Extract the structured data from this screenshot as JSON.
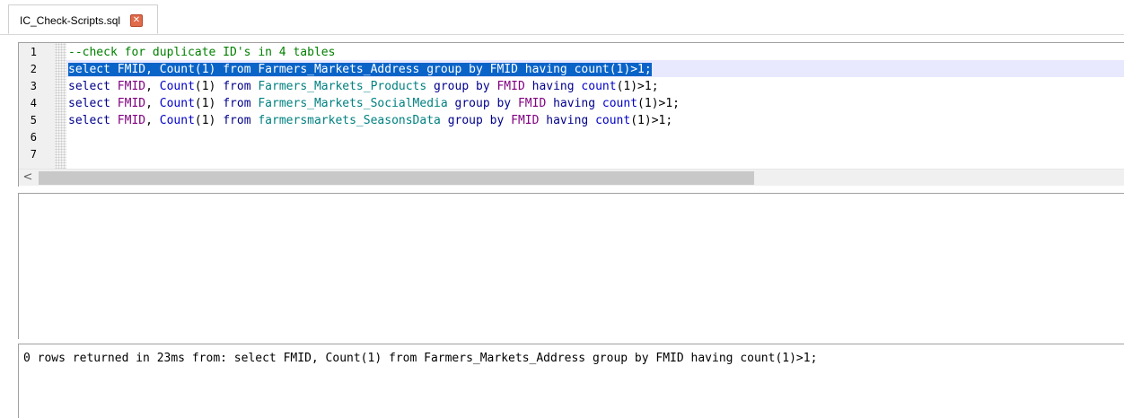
{
  "tabs": [
    {
      "label": "IC_Check-Scripts.sql",
      "close_icon": "close-icon",
      "close_glyph": "✕",
      "close_color": "#e06a4a"
    }
  ],
  "editor": {
    "line_numbers": [
      "1",
      "2",
      "3",
      "4",
      "5",
      "6",
      "7"
    ],
    "selected_line": "2",
    "lines": [
      {
        "tokens": [
          {
            "t": "--check for duplicate ID's in 4 tables",
            "k": "comment"
          }
        ]
      },
      {
        "tokens": [
          {
            "t": "select",
            "k": "kw"
          },
          {
            "t": " "
          },
          {
            "t": "FMID",
            "k": "ident"
          },
          {
            "t": ", "
          },
          {
            "t": "Count",
            "k": "func"
          },
          {
            "t": "(1) "
          },
          {
            "t": "from",
            "k": "kw"
          },
          {
            "t": " "
          },
          {
            "t": "Farmers_Markets_Address",
            "k": "table"
          },
          {
            "t": " "
          },
          {
            "t": "group by",
            "k": "kw"
          },
          {
            "t": " "
          },
          {
            "t": "FMID",
            "k": "ident"
          },
          {
            "t": " "
          },
          {
            "t": "having",
            "k": "kw"
          },
          {
            "t": " "
          },
          {
            "t": "count",
            "k": "func"
          },
          {
            "t": "(1)>1;"
          }
        ]
      },
      {
        "tokens": [
          {
            "t": "select",
            "k": "kw"
          },
          {
            "t": " "
          },
          {
            "t": "FMID",
            "k": "ident"
          },
          {
            "t": ", "
          },
          {
            "t": "Count",
            "k": "func"
          },
          {
            "t": "(1) "
          },
          {
            "t": "from",
            "k": "kw"
          },
          {
            "t": " "
          },
          {
            "t": "Farmers_Markets_Products",
            "k": "table"
          },
          {
            "t": " "
          },
          {
            "t": "group by",
            "k": "kw"
          },
          {
            "t": " "
          },
          {
            "t": "FMID",
            "k": "ident"
          },
          {
            "t": " "
          },
          {
            "t": "having",
            "k": "kw"
          },
          {
            "t": " "
          },
          {
            "t": "count",
            "k": "func"
          },
          {
            "t": "(1)>1;"
          }
        ]
      },
      {
        "tokens": [
          {
            "t": "select",
            "k": "kw"
          },
          {
            "t": " "
          },
          {
            "t": "FMID",
            "k": "ident"
          },
          {
            "t": ", "
          },
          {
            "t": "Count",
            "k": "func"
          },
          {
            "t": "(1) "
          },
          {
            "t": "from",
            "k": "kw"
          },
          {
            "t": " "
          },
          {
            "t": "Farmers_Markets_SocialMedia",
            "k": "table"
          },
          {
            "t": " "
          },
          {
            "t": "group by",
            "k": "kw"
          },
          {
            "t": " "
          },
          {
            "t": "FMID",
            "k": "ident"
          },
          {
            "t": " "
          },
          {
            "t": "having",
            "k": "kw"
          },
          {
            "t": " "
          },
          {
            "t": "count",
            "k": "func"
          },
          {
            "t": "(1)>1;"
          }
        ]
      },
      {
        "tokens": [
          {
            "t": "select",
            "k": "kw"
          },
          {
            "t": " "
          },
          {
            "t": "FMID",
            "k": "ident"
          },
          {
            "t": ", "
          },
          {
            "t": "Count",
            "k": "func"
          },
          {
            "t": "(1) "
          },
          {
            "t": "from",
            "k": "kw"
          },
          {
            "t": " "
          },
          {
            "t": "farmersmarkets_SeasonsData",
            "k": "table"
          },
          {
            "t": " "
          },
          {
            "t": "group by",
            "k": "kw"
          },
          {
            "t": " "
          },
          {
            "t": "FMID",
            "k": "ident"
          },
          {
            "t": " "
          },
          {
            "t": "having",
            "k": "kw"
          },
          {
            "t": " "
          },
          {
            "t": "count",
            "k": "func"
          },
          {
            "t": "(1)>1;"
          }
        ]
      },
      {
        "tokens": []
      },
      {
        "tokens": []
      }
    ],
    "scroll_left_glyph": "<",
    "selection_color": "#0a64c8"
  },
  "message": {
    "text": "0 rows returned in 23ms from: select FMID, Count(1) from Farmers_Markets_Address group by FMID having count(1)>1;"
  }
}
